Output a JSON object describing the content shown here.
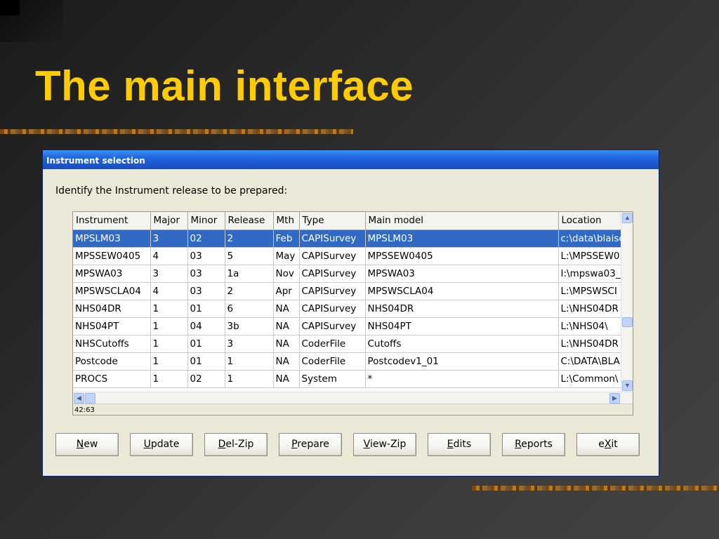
{
  "slide": {
    "title": "The main interface"
  },
  "window": {
    "title": "Instrument selection",
    "prompt": "Identify the Instrument release to be prepared:",
    "status": "42:63"
  },
  "table": {
    "columns": [
      "Instrument",
      "Major",
      "Minor",
      "Release",
      "Mth",
      "Type",
      "Main model",
      "Location"
    ],
    "selected_row": 0,
    "rows": [
      [
        "MPSLM03",
        "3",
        "02",
        "2",
        "Feb",
        "CAPISurvey",
        "MPSLM03",
        "c:\\data\\blaise"
      ],
      [
        "MPSSEW0405",
        "4",
        "03",
        "5",
        "May",
        "CAPISurvey",
        "MPSSEW0405",
        "L:\\MPSSEW0"
      ],
      [
        "MPSWA03",
        "3",
        "03",
        "1a",
        "Nov",
        "CAPISurvey",
        "MPSWA03",
        "I:\\mpswa03_"
      ],
      [
        "MPSWSCLA04",
        "4",
        "03",
        "2",
        "Apr",
        "CAPISurvey",
        "MPSWSCLA04",
        "L:\\MPSWSCI"
      ],
      [
        "NHS04DR",
        "1",
        "01",
        "6",
        "NA",
        "CAPISurvey",
        "NHS04DR",
        "L:\\NHS04DR"
      ],
      [
        "NHS04PT",
        "1",
        "04",
        "3b",
        "NA",
        "CAPISurvey",
        "NHS04PT",
        "L:\\NHS04\\"
      ],
      [
        "NHSCutoffs",
        "1",
        "01",
        "3",
        "NA",
        "CoderFile",
        "Cutoffs",
        "L:\\NHS04DR"
      ],
      [
        "Postcode",
        "1",
        "01",
        "1",
        "NA",
        "CoderFile",
        "Postcodev1_01",
        "C:\\DATA\\BLA"
      ],
      [
        "PROCS",
        "1",
        "02",
        "1",
        "NA",
        "System",
        "*",
        "L:\\Common\\"
      ]
    ]
  },
  "buttons": [
    {
      "key": "N",
      "rest": "ew",
      "pre": ""
    },
    {
      "key": "U",
      "rest": "pdate",
      "pre": ""
    },
    {
      "key": "D",
      "rest": "el-Zip",
      "pre": ""
    },
    {
      "key": "P",
      "rest": "repare",
      "pre": ""
    },
    {
      "key": "V",
      "rest": "iew-Zip",
      "pre": ""
    },
    {
      "key": "E",
      "rest": "dits",
      "pre": ""
    },
    {
      "key": "R",
      "rest": "eports",
      "pre": ""
    },
    {
      "key": "X",
      "rest": "it",
      "pre": "e"
    }
  ],
  "icons": {
    "scroll_up": "chevron-up-icon",
    "scroll_down": "chevron-down-icon",
    "scroll_left": "chevron-left-icon",
    "scroll_right": "chevron-right-icon"
  },
  "colors": {
    "title": "#ffcc00",
    "selection": "#316ac5",
    "titlebar": "#1d62dc",
    "dialog_bg": "#ece9d8"
  }
}
